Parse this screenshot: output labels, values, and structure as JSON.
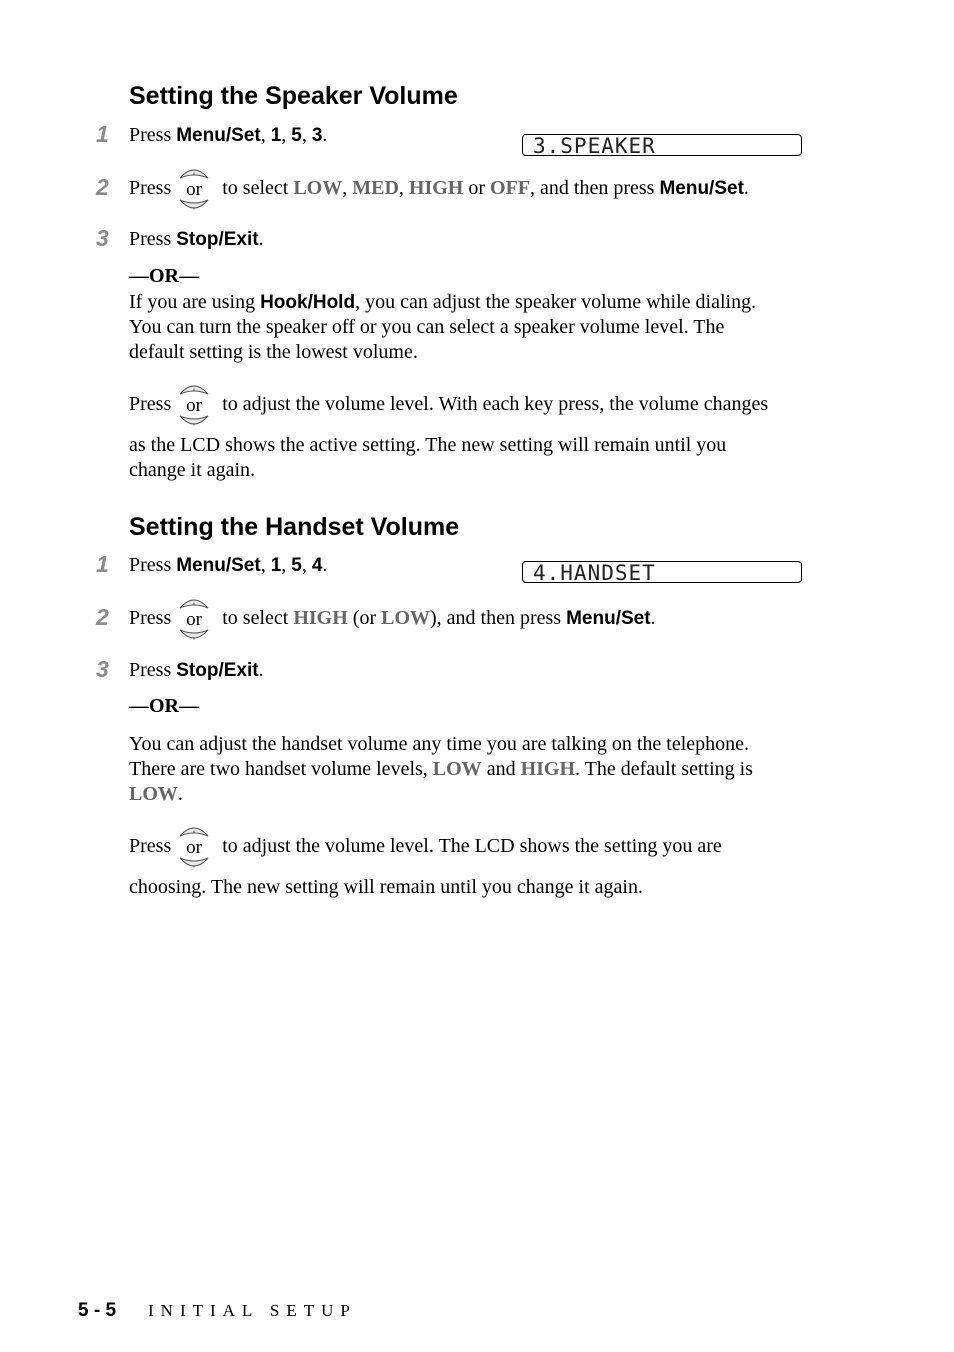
{
  "sections": [
    {
      "title": "Setting the Speaker Volume",
      "lcd": "3.SPEAKER",
      "steps": [
        {
          "num": "1",
          "press": "Press ",
          "key": "Menu/Set",
          "sep1": ", ",
          "d1": "1",
          "sep2": ", ",
          "d2": "5",
          "sep3": ", ",
          "d3": "3",
          "end": "."
        },
        {
          "num": "2",
          "press": "Press",
          "mid": " to select ",
          "o1": "LOW",
          "c1": ", ",
          "o2": "MED",
          "c2": ", ",
          "o3": "HIGH",
          "c3": " or ",
          "o4": "OFF",
          "tail": ", and then press ",
          "key": "Menu/Set",
          "end": "."
        },
        {
          "num": "3",
          "press": "Press ",
          "key": "Stop/Exit",
          "end": "."
        }
      ],
      "or": "—OR—",
      "para1": {
        "a": "If you are using ",
        "key": "Hook/Hold",
        "b": ", you can adjust the speaker volume while dialing.",
        "l2": "You can turn the speaker off or you can select a speaker volume level. The",
        "l3": "default setting is the lowest volume."
      },
      "para2": {
        "press": "Press",
        "a": " to adjust the volume level. With each key press, the volume changes",
        "l2": "as the LCD shows the active setting. The new setting will remain until you",
        "l3": "change it again."
      }
    },
    {
      "title": "Setting the Handset Volume",
      "lcd": "4.HANDSET",
      "steps": [
        {
          "num": "1",
          "press": "Press ",
          "key": "Menu/Set",
          "sep1": ", ",
          "d1": "1",
          "sep2": ", ",
          "d2": "5",
          "sep3": ", ",
          "d3": "4",
          "end": "."
        },
        {
          "num": "2",
          "press": "Press",
          "mid": " to select ",
          "o1": "HIGH",
          "c1": " (or ",
          "o2": "LOW",
          "tail": "), and then press ",
          "key": "Menu/Set",
          "end": "."
        },
        {
          "num": "3",
          "press": "Press ",
          "key": "Stop/Exit",
          "end": "."
        }
      ],
      "or": "—OR—",
      "para1": {
        "l1": "You can adjust the handset volume any time you are talking on the telephone.",
        "l2a": "There are two handset volume levels, ",
        "o1": "LOW",
        "l2b": " and ",
        "o2": "HIGH",
        "l2c": ". The default setting is",
        "o3": "LOW",
        "l3end": "."
      },
      "para2": {
        "press": "Press",
        "a": " to adjust the volume level. The LCD shows the setting you are",
        "l2": "choosing. The new setting will remain until you change it again."
      }
    }
  ],
  "key_icon": {
    "label": "or",
    "name": "up-down-navigation-key"
  },
  "footer": {
    "page": "5 - 5",
    "chapter": "INITIAL SETUP"
  }
}
